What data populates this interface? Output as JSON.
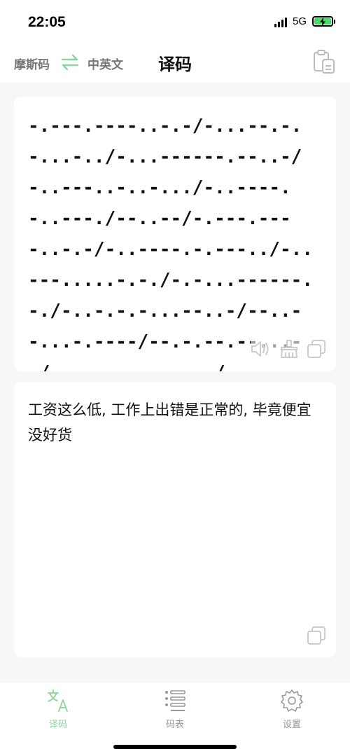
{
  "status_bar": {
    "time": "22:05",
    "network": "5G"
  },
  "nav": {
    "lang_from": "摩斯码",
    "lang_to": "中英文",
    "title": "译码"
  },
  "morse_card": {
    "text": "-.---.----..-.-/-...--.-.-...-../-...------.--..-/-..---..-..-.../-..----.-..---./--..--/-.---.----..-.-/-..----.-.---../-..---.....-.-./-.-...------.-./-..-.-.-...--..-/--..--...-.----/--.-.--.--...--/-.----...---.../---.--.-....-../--..--/--.-.----.-.--/----.-.--.-----/-..-----------.------/-----.------/-"
  },
  "plain_card": {
    "text": "工资这么低, 工作上出错是正常的, 毕竟便宜没好货"
  },
  "tabs": [
    {
      "label": "译码",
      "active": true
    },
    {
      "label": "码表",
      "active": false
    },
    {
      "label": "设置",
      "active": false
    }
  ],
  "colors": {
    "accent": "#8fd39c",
    "background": "#f7f7f9",
    "battery": "#4cd964"
  }
}
